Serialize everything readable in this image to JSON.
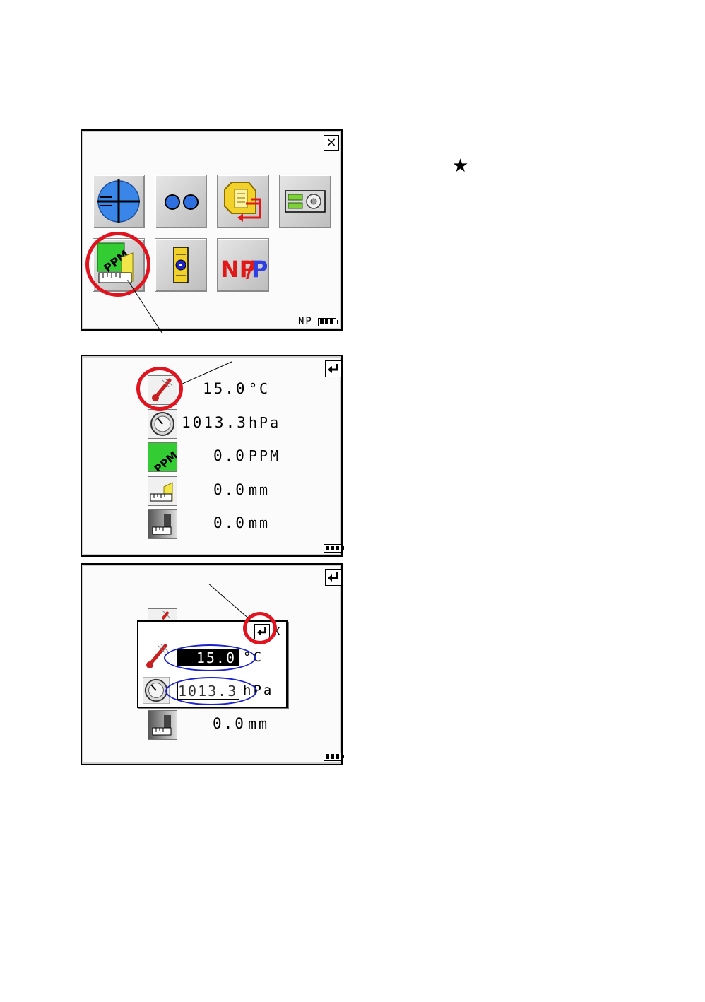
{
  "annotation": {
    "star": "★"
  },
  "screen1": {
    "close_icon": "×",
    "status": "NP",
    "tiles": [
      {
        "icon": "target-icon"
      },
      {
        "icon": "two-circles-icon"
      },
      {
        "icon": "prism-export-icon"
      },
      {
        "icon": "settings-box-icon"
      },
      {
        "icon": "ppm-correction-icon"
      },
      {
        "icon": "level-icon"
      },
      {
        "icon": "np-p-icon",
        "label_np": "NP",
        "label_slash": "/",
        "label_p": "P"
      }
    ]
  },
  "screen2": {
    "rows": [
      {
        "icon": "thermometer-icon",
        "value": "15.0",
        "unit": "°C"
      },
      {
        "icon": "barometer-icon",
        "value": "1013.3",
        "unit": "hPa"
      },
      {
        "icon": "ppm-icon",
        "label": "PPM",
        "value": "0.0",
        "unit": "PPM"
      },
      {
        "icon": "prism-constant-icon",
        "value": "0.0",
        "unit": "mm"
      },
      {
        "icon": "reflector-sheet-icon",
        "value": "0.0",
        "unit": "mm"
      }
    ]
  },
  "screen3": {
    "background_row_value": "0.0",
    "background_row_unit": "mm",
    "popup": {
      "close_icon": "x",
      "temperature_value": "15.0",
      "temperature_unit": "°C",
      "pressure_value": "1013.3",
      "pressure_unit": "hPa"
    }
  },
  "colors": {
    "highlight_red": "#e0141e",
    "highlight_blue": "#1a22c8",
    "ppm_green": "#33cc33",
    "np_red": "#e01818",
    "p_blue": "#3040e0"
  }
}
